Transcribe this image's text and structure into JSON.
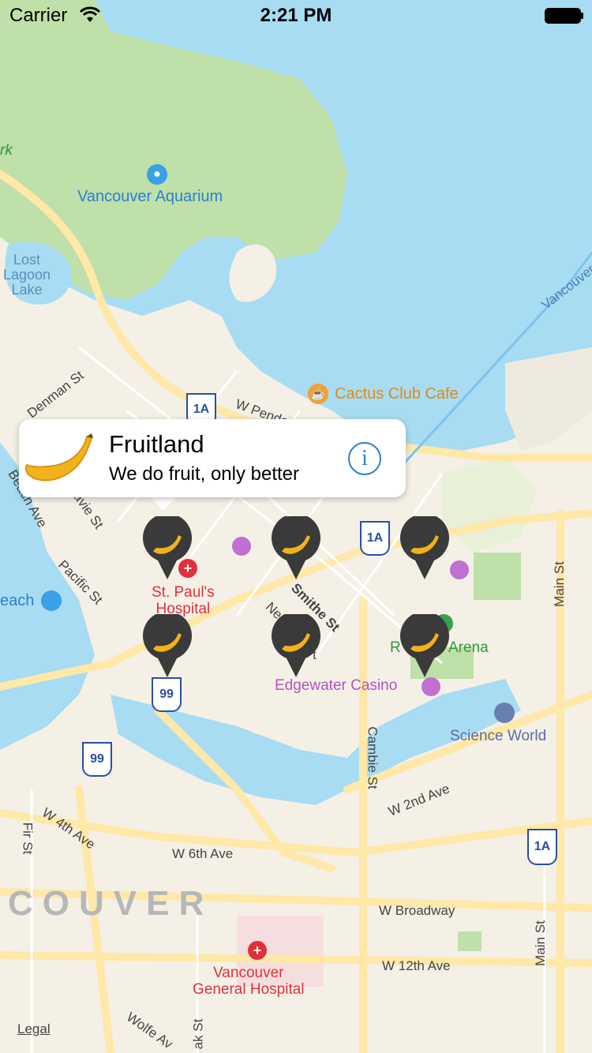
{
  "status_bar": {
    "carrier": "Carrier",
    "time": "2:21 PM"
  },
  "map": {
    "water_labels": [
      {
        "text": "Lost\nLagoon\nLake"
      }
    ],
    "poi": {
      "aquarium": "Vancouver Aquarium",
      "cactus_club": "Cactus Club Cafe",
      "st_pauls": "St. Paul's\nHospital",
      "edgewater": "Edgewater Casino",
      "rogers_arena": "Arena",
      "rogers_r": "R",
      "science_world": "Science World",
      "general_hospital": "Vancouver\nGeneral Hospital",
      "beach": "each",
      "park": "rk"
    },
    "streets": {
      "denman": "Denman St",
      "w_pender": "W Pender St",
      "davie": "Davie St",
      "beach_ave": "Beach Ave",
      "pacific": "Pacific St",
      "smithe": "Smithe St",
      "nelson_frag": "Ne",
      "nelson_frag2": "t",
      "main_top": "Main St",
      "main_bottom": "Main St",
      "cambie": "Cambie St",
      "w_2nd": "W 2nd Ave",
      "w_4th": "W 4th Ave",
      "fir": "Fir St",
      "w_6th": "W 6th Ave",
      "w_broadway": "W Broadway",
      "w_12th": "W 12th Ave",
      "wolfe": "Wolfe Av",
      "oak": "ak St",
      "vancouver_road": "Vancouver"
    },
    "district": "COUVER",
    "shields": [
      "1A",
      "1A",
      "99",
      "99",
      "1A"
    ],
    "legal": "Legal"
  },
  "callout": {
    "title": "Fruitland",
    "subtitle": "We do fruit, only better",
    "info_glyph": "i"
  },
  "pins": [
    {
      "id": 1,
      "icon": "banana-icon"
    },
    {
      "id": 2,
      "icon": "banana-icon"
    },
    {
      "id": 3,
      "icon": "banana-icon"
    },
    {
      "id": 4,
      "icon": "banana-icon"
    },
    {
      "id": 5,
      "icon": "banana-icon"
    },
    {
      "id": 6,
      "icon": "banana-icon"
    }
  ],
  "colors": {
    "water": "#a8dcf2",
    "park": "#bfe0a8",
    "land": "#f4f0e6",
    "road": "#ffe8a8",
    "banana": "#f2b21b",
    "pin": "#3a3a3a",
    "accent": "#2a7fd3"
  }
}
